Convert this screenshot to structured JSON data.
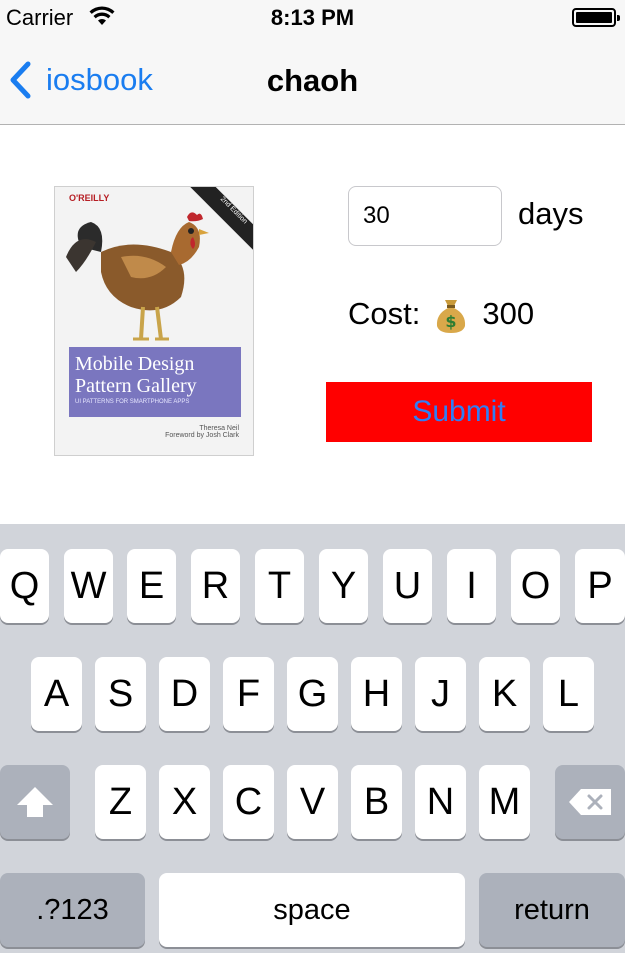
{
  "status_bar": {
    "carrier": "Carrier",
    "time": "8:13 PM",
    "wifi_icon": "wifi-icon",
    "battery_icon": "battery-full-icon"
  },
  "nav": {
    "back_label": "iosbook",
    "back_icon": "chevron-left-icon",
    "title": "chaoh",
    "accent_color": "#1a7df0"
  },
  "book": {
    "publisher": "O'REILLY",
    "edition": "2nd Edition",
    "title": "Mobile Design Pattern Gallery",
    "subtitle": "UI PATTERNS FOR SMARTPHONE APPS",
    "author": "Theresa Neil",
    "foreword": "Foreword by Josh Clark"
  },
  "form": {
    "days_value": "30",
    "days_label": "days",
    "cost_label": "Cost:",
    "cost_icon": "money-bag-icon",
    "cost_value": "300",
    "submit_label": "Submit",
    "submit_bg": "#ff0000",
    "submit_text_color": "#2f7ef5"
  },
  "keyboard": {
    "row1": [
      "Q",
      "W",
      "E",
      "R",
      "T",
      "Y",
      "U",
      "I",
      "O",
      "P"
    ],
    "row2": [
      "A",
      "S",
      "D",
      "F",
      "G",
      "H",
      "J",
      "K",
      "L"
    ],
    "row3": [
      "Z",
      "X",
      "C",
      "V",
      "B",
      "N",
      "M"
    ],
    "shift_icon": "shift-icon",
    "delete_icon": "delete-icon",
    "numbers_label": ".?123",
    "space_label": "space",
    "return_label": "return"
  }
}
